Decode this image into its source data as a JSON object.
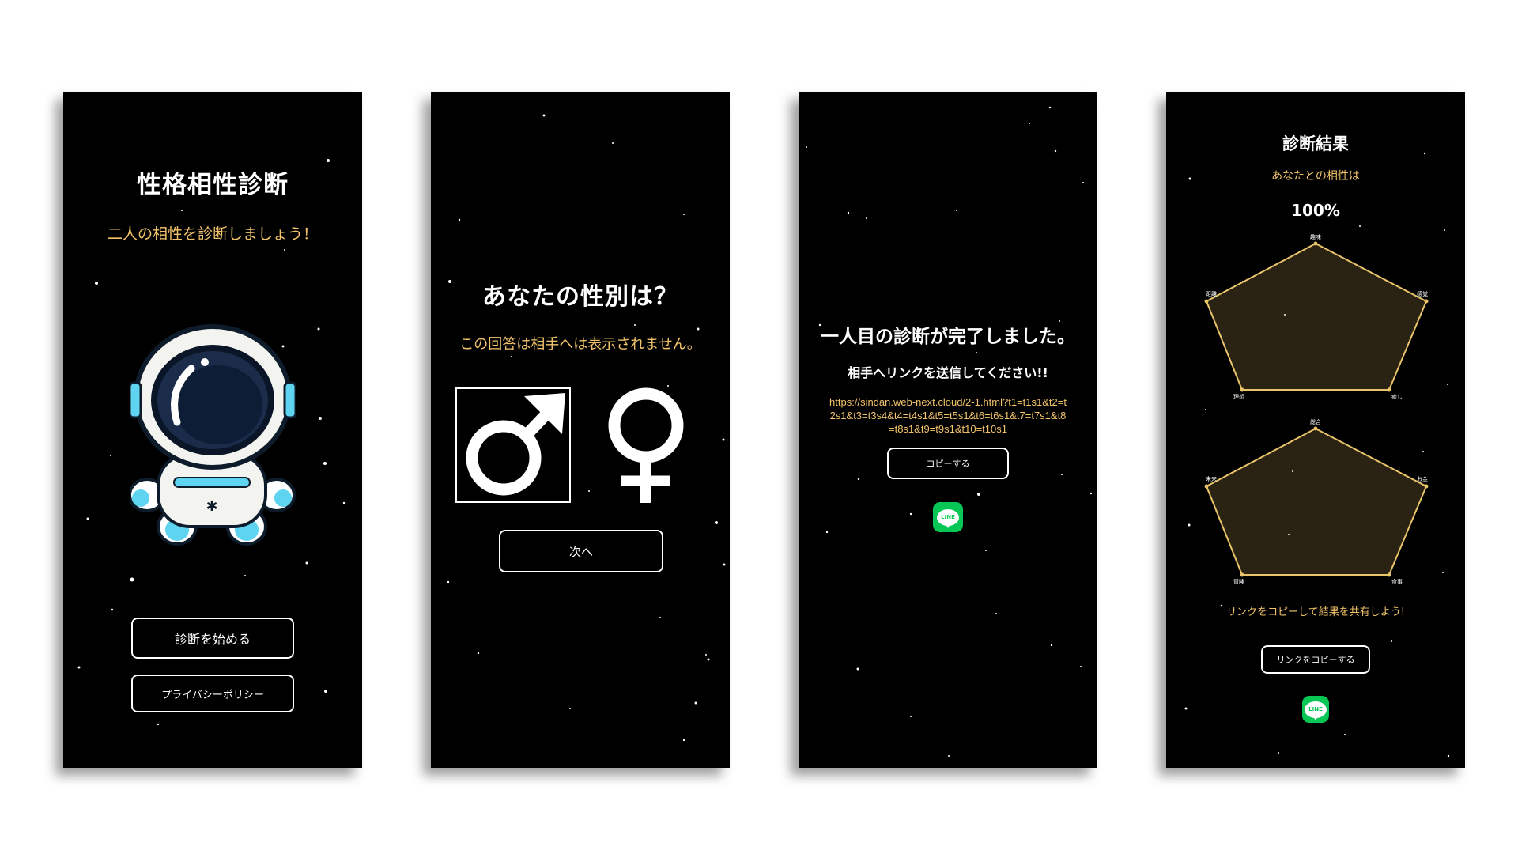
{
  "screens": {
    "start": {
      "title": "性格相性診断",
      "subtitle": "二人の相性を診断しましょう！",
      "start_button": "診断を始める",
      "privacy_button": "プライバシーポリシー"
    },
    "gender": {
      "title": "あなたの性別は？",
      "note": "この回答は相手へは表示されません。",
      "male_symbol": "♂",
      "female_symbol": "♀",
      "selected": "male",
      "next_button": "次へ"
    },
    "complete": {
      "title": "一人目の診断が完了しました。",
      "instruction": "相手へリンクを送信してください!!",
      "link_line1": "https://sindan.web-next.cloud/2-1.html?t1=t1s1&t2=t",
      "link_line2": "2s1&t3=t3s4&t4=t4s1&t5=t5s1&t6=t6s1&t7=t7s1&t8",
      "link_line3": "=t8s1&t9=t9s1&t10=t10s1",
      "copy_button": "コピーする",
      "line_label": "LINE"
    },
    "result": {
      "title": "診断結果",
      "subtitle": "あなたとの相性は",
      "percent": "100%",
      "radar1_labels": [
        "趣味",
        "感覚",
        "癒し",
        "理想",
        "距離"
      ],
      "radar2_labels": [
        "総合",
        "お金",
        "食事",
        "冒険",
        "未来"
      ],
      "share_text": "リンクをコピーして結果を共有しよう!",
      "copy_link_button": "リンクをコピーする",
      "line_label": "LINE"
    }
  },
  "colors": {
    "background": "#000000",
    "accent_gold": "#f2c36b",
    "radar_stroke": "#e9c46a",
    "line_green": "#06c755"
  }
}
